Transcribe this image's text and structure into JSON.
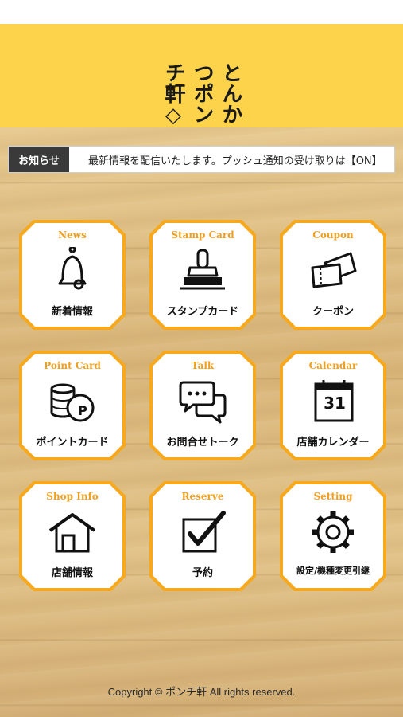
{
  "logo": {
    "col1": "とんか",
    "col2": "つポン",
    "col3": "チ軒◇"
  },
  "notice": {
    "tag": "お知らせ",
    "text": "最新情報を配信いたします。プッシュ通知の受け取りは【ON】"
  },
  "menu": [
    {
      "en": "News",
      "jp": "新着情報",
      "icon": "bell-icon"
    },
    {
      "en": "Stamp Card",
      "jp": "スタンプカード",
      "icon": "stamp-icon"
    },
    {
      "en": "Coupon",
      "jp": "クーポン",
      "icon": "coupon-icon"
    },
    {
      "en": "Point Card",
      "jp": "ポイントカード",
      "icon": "coins-icon"
    },
    {
      "en": "Talk",
      "jp": "お問合せトーク",
      "icon": "chat-icon"
    },
    {
      "en": "Calendar",
      "jp": "店舗カレンダー",
      "icon": "calendar-icon"
    },
    {
      "en": "Shop Info",
      "jp": "店舗情報",
      "icon": "house-icon"
    },
    {
      "en": "Reserve",
      "jp": "予約",
      "icon": "checkbox-icon"
    },
    {
      "en": "Setting",
      "jp": "設定/機種変更引継",
      "icon": "gear-icon"
    }
  ],
  "calendar_day": "31",
  "point_letter": "P",
  "footer": "Copyright © ポンチ軒 All rights reserved.",
  "colors": {
    "header": "#fcd34a",
    "tile_border": "#f6a81e",
    "tile_label": "#f0a020",
    "notice_tag": "#3a3a3a"
  }
}
